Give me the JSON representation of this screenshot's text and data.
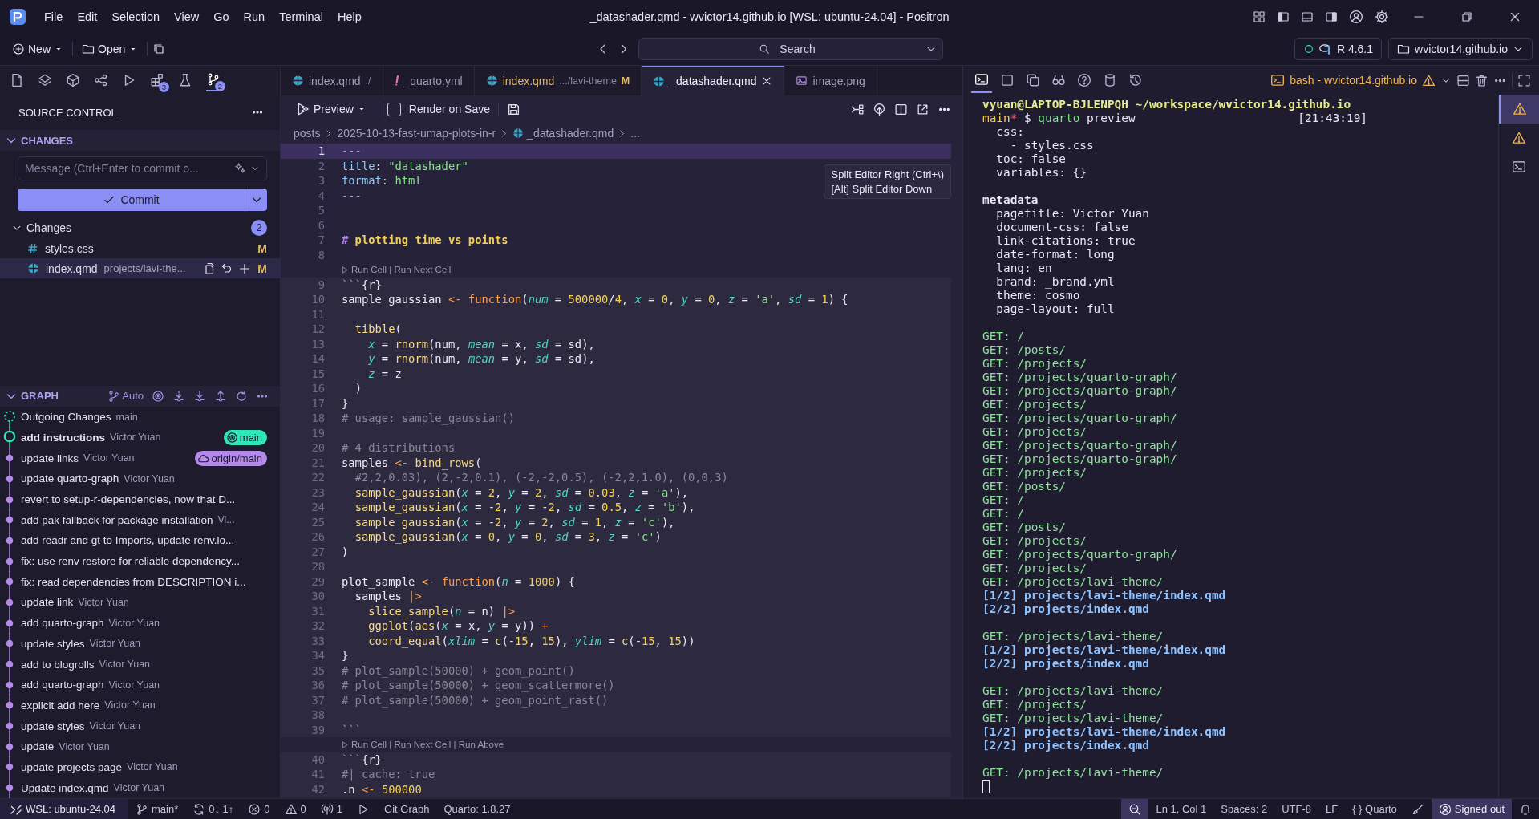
{
  "title_bar": {
    "menu": [
      "File",
      "Edit",
      "Selection",
      "View",
      "Go",
      "Run",
      "Terminal",
      "Help"
    ],
    "title": "_datashader.qmd - wvictor14.github.io [WSL: ubuntu-24.04] - Positron"
  },
  "toolbar": {
    "new": "New",
    "open": "Open",
    "search": {
      "placeholder": "Search"
    },
    "interpreter": "R 4.6.1",
    "workspace": "wvictor14.github.io"
  },
  "activity": [
    {
      "kind": "files",
      "selected": false
    },
    {
      "kind": "layers",
      "selected": false
    },
    {
      "kind": "cube",
      "selected": false
    },
    {
      "kind": "share",
      "selected": false
    },
    {
      "kind": "run",
      "selected": false
    },
    {
      "kind": "blocks",
      "badge": "3",
      "selected": false
    },
    {
      "kind": "flask",
      "selected": false
    },
    {
      "kind": "branch",
      "badge": "2",
      "selected": true
    }
  ],
  "source_control": {
    "title": "SOURCE CONTROL",
    "section": "CHANGES",
    "message": {
      "placeholder": "Message (Ctrl+Enter to commit o..."
    },
    "commit": "Commit",
    "group": {
      "label": "Changes",
      "count": "2"
    },
    "files": [
      {
        "kind": "css",
        "name": "styles.css",
        "status": "M",
        "selected": false
      },
      {
        "kind": "qmd",
        "name": "index.qmd",
        "path": "projects/lavi-the...",
        "status": "M",
        "selected": true
      }
    ]
  },
  "graph": {
    "title": "GRAPH",
    "mode": "Auto",
    "commits": [
      {
        "kind": "outgoing",
        "message": "Outgoing Changes",
        "author": "main"
      },
      {
        "kind": "head",
        "message": "add instructions",
        "author": "Victor Yuan",
        "refs": [
          {
            "kind": "local",
            "label": "main"
          }
        ]
      },
      {
        "kind": "commit",
        "message": "update links",
        "author": "Victor Yuan",
        "refs": [
          {
            "kind": "remote",
            "label": "origin/main"
          }
        ]
      },
      {
        "kind": "commit",
        "message": "update quarto-graph",
        "author": "Victor Yuan"
      },
      {
        "kind": "commit",
        "message": "revert to setup-r-dependencies, now that D..."
      },
      {
        "kind": "commit",
        "message": "add pak fallback for package installation",
        "author": "Vi..."
      },
      {
        "kind": "commit",
        "message": "add readr and gt to Imports, update renv.lo..."
      },
      {
        "kind": "commit",
        "message": "fix: use renv restore for reliable dependency..."
      },
      {
        "kind": "commit",
        "message": "fix: read dependencies from DESCRIPTION i..."
      },
      {
        "kind": "commit",
        "message": "update link",
        "author": "Victor Yuan"
      },
      {
        "kind": "commit",
        "message": "add quarto-graph",
        "author": "Victor Yuan"
      },
      {
        "kind": "commit",
        "message": "update styles",
        "author": "Victor Yuan"
      },
      {
        "kind": "commit",
        "message": "add to blogrolls",
        "author": "Victor Yuan"
      },
      {
        "kind": "commit",
        "message": "add quarto-graph",
        "author": "Victor Yuan"
      },
      {
        "kind": "commit",
        "message": "explicit add here",
        "author": "Victor Yuan"
      },
      {
        "kind": "commit",
        "message": "update styles",
        "author": "Victor Yuan"
      },
      {
        "kind": "commit",
        "message": "update",
        "author": "Victor Yuan"
      },
      {
        "kind": "commit",
        "message": "update projects page",
        "author": "Victor Yuan"
      },
      {
        "kind": "commit",
        "message": "Update index.qmd",
        "author": "Victor Yuan"
      }
    ]
  },
  "tabs": [
    {
      "kind": "qmd",
      "label": "index.qmd",
      "description": "./",
      "selected": false
    },
    {
      "kind": "yml",
      "label": "_quarto.yml",
      "selected": false
    },
    {
      "kind": "qmd",
      "label": "index.qmd",
      "description": ".../lavi-theme",
      "status": "M",
      "selected": false
    },
    {
      "kind": "qmd",
      "label": "_datashader.qmd",
      "selected": true
    },
    {
      "kind": "png",
      "label": "image.png",
      "selected": false
    }
  ],
  "editor": {
    "preview": "Preview",
    "render_on_save": {
      "label": "Render on Save",
      "checked": false
    },
    "tooltip": [
      "Split Editor Right (Ctrl+\\)",
      "[Alt] Split Editor Down"
    ],
    "breadcrumbs": [
      "posts",
      "2025-10-13-fast-umap-plots-in-r",
      "_datashader.qmd",
      "..."
    ],
    "blocks": [
      {
        "kind": "yaml",
        "lines": [
          {
            "n": "1",
            "text": "---",
            "current": true
          },
          {
            "n": "2",
            "text": "title: \"datashader\"",
            "current": false
          },
          {
            "n": "3",
            "text": "format: html",
            "current": false
          },
          {
            "n": "4",
            "text": "---",
            "current": false
          }
        ]
      },
      {
        "kind": "markdown",
        "lines": [
          {
            "n": "5",
            "current": false
          },
          {
            "n": "6",
            "current": false
          },
          {
            "n": "7",
            "text": "# plotting time vs points",
            "current": false
          },
          {
            "n": "8",
            "current": false
          }
        ]
      },
      {
        "kind": "chunk",
        "codelens": "Run Cell | Run Next Cell",
        "lines": [
          {
            "n": "9",
            "text": "```{r}",
            "current": false
          },
          {
            "n": "10",
            "text": "sample_gaussian <- function(num = 500000/4, x = 0, y = 0, z = 'a', sd = 1) {",
            "current": false
          },
          {
            "n": "11",
            "current": false
          },
          {
            "n": "12",
            "text": "  tibble(",
            "current": false
          },
          {
            "n": "13",
            "text": "    x = rnorm(num, mean = x, sd = sd),",
            "current": false
          },
          {
            "n": "14",
            "text": "    y = rnorm(num, mean = y, sd = sd),",
            "current": false
          },
          {
            "n": "15",
            "text": "    z = z",
            "current": false
          },
          {
            "n": "16",
            "text": "  )",
            "current": false
          },
          {
            "n": "17",
            "text": "}",
            "current": false
          },
          {
            "n": "18",
            "text": "# usage: sample_gaussian()",
            "current": false
          },
          {
            "n": "19",
            "current": false
          },
          {
            "n": "20",
            "text": "# 4 distributions",
            "current": false
          },
          {
            "n": "21",
            "text": "samples <- bind_rows(",
            "current": false
          },
          {
            "n": "22",
            "text": "  #2,2,0.03), (2,-2,0.1), (-2,-2,0.5), (-2,2,1.0), (0,0,3)",
            "current": false
          },
          {
            "n": "23",
            "text": "  sample_gaussian(x = 2, y = 2, sd = 0.03, z = 'a'),",
            "current": false
          },
          {
            "n": "24",
            "text": "  sample_gaussian(x = -2, y = -2, sd = 0.5, z = 'b'),",
            "current": false
          },
          {
            "n": "25",
            "text": "  sample_gaussian(x = -2, y = 2, sd = 1, z = 'c'),",
            "current": false
          },
          {
            "n": "26",
            "text": "  sample_gaussian(x = 0, y = 0, sd = 3, z = 'c')",
            "current": false
          },
          {
            "n": "27",
            "text": ")",
            "current": false
          },
          {
            "n": "28",
            "current": false
          },
          {
            "n": "29",
            "text": "plot_sample <- function(n = 1000) {",
            "current": false
          },
          {
            "n": "30",
            "text": "  samples |>",
            "current": false
          },
          {
            "n": "31",
            "text": "    slice_sample(n = n) |>",
            "current": false
          },
          {
            "n": "32",
            "text": "    ggplot(aes(x = x, y = y)) +",
            "current": false
          },
          {
            "n": "33",
            "text": "    coord_equal(xlim = c(-15, 15), ylim = c(-15, 15))",
            "current": false
          },
          {
            "n": "34",
            "text": "}",
            "current": false
          },
          {
            "n": "35",
            "text": "# plot_sample(50000) + geom_point()",
            "current": false
          },
          {
            "n": "36",
            "text": "# plot_sample(50000) + geom_scattermore()",
            "current": false
          },
          {
            "n": "37",
            "text": "# plot_sample(50000) + geom_point_rast()",
            "current": false
          },
          {
            "n": "38",
            "current": false
          },
          {
            "n": "39",
            "text": "```",
            "current": false
          }
        ]
      },
      {
        "kind": "chunk",
        "codelens": "Run Cell | Run Next Cell | Run Above",
        "lines": [
          {
            "n": "40",
            "text": "```{r}",
            "current": false
          },
          {
            "n": "41",
            "text": "#| cache: true",
            "current": false
          },
          {
            "n": "42",
            "text": ".n <- 500000",
            "current": false
          }
        ]
      }
    ]
  },
  "terminal": {
    "tabs": [
      {
        "kind": "terminal",
        "selected": true
      },
      {
        "kind": "square",
        "selected": false
      },
      {
        "kind": "copy",
        "selected": false
      },
      {
        "kind": "glasses",
        "selected": false
      },
      {
        "kind": "help",
        "selected": false
      },
      {
        "kind": "database",
        "selected": false
      },
      {
        "kind": "history",
        "selected": false
      }
    ],
    "session": "bash - wvictor14.github.io",
    "side": [
      {
        "kind": "warning",
        "selected": true
      },
      {
        "kind": "warning",
        "selected": false
      },
      {
        "kind": "terminal",
        "selected": false
      }
    ],
    "lines": [
      {
        "kind": "path",
        "text": "vyuan@LAPTOP-BJLENPQH ~/workspace/wvictor14.github.io"
      },
      {
        "kind": "command",
        "branch": "main",
        "dirty": "*",
        "symbol": "$",
        "command": "quarto",
        "args": "preview",
        "time": "[21:43:19]"
      },
      {
        "kind": "plain",
        "text": "  css:"
      },
      {
        "kind": "plain",
        "text": "    - styles.css"
      },
      {
        "kind": "plain",
        "text": "  toc: false"
      },
      {
        "kind": "plain",
        "text": "  variables: {}"
      },
      {
        "kind": "blank"
      },
      {
        "kind": "heading",
        "text": "metadata"
      },
      {
        "kind": "plain",
        "text": "  pagetitle: Victor Yuan"
      },
      {
        "kind": "plain",
        "text": "  document-css: false"
      },
      {
        "kind": "plain",
        "text": "  link-citations: true"
      },
      {
        "kind": "plain",
        "text": "  date-format: long"
      },
      {
        "kind": "plain",
        "text": "  lang: en"
      },
      {
        "kind": "plain",
        "text": "  brand: _brand.yml"
      },
      {
        "kind": "plain",
        "text": "  theme: cosmo"
      },
      {
        "kind": "plain",
        "text": "  page-layout: full"
      },
      {
        "kind": "blank"
      },
      {
        "kind": "get",
        "text": "GET: /"
      },
      {
        "kind": "get",
        "text": "GET: /posts/"
      },
      {
        "kind": "get",
        "text": "GET: /projects/"
      },
      {
        "kind": "get",
        "text": "GET: /projects/quarto-graph/"
      },
      {
        "kind": "get",
        "text": "GET: /projects/quarto-graph/"
      },
      {
        "kind": "get",
        "text": "GET: /projects/"
      },
      {
        "kind": "get",
        "text": "GET: /projects/quarto-graph/"
      },
      {
        "kind": "get",
        "text": "GET: /projects/"
      },
      {
        "kind": "get",
        "text": "GET: /projects/quarto-graph/"
      },
      {
        "kind": "get",
        "text": "GET: /projects/quarto-graph/"
      },
      {
        "kind": "get",
        "text": "GET: /projects/"
      },
      {
        "kind": "get",
        "text": "GET: /posts/"
      },
      {
        "kind": "get",
        "text": "GET: /"
      },
      {
        "kind": "get",
        "text": "GET: /"
      },
      {
        "kind": "get",
        "text": "GET: /posts/"
      },
      {
        "kind": "get",
        "text": "GET: /projects/"
      },
      {
        "kind": "get",
        "text": "GET: /projects/quarto-graph/"
      },
      {
        "kind": "get",
        "text": "GET: /projects/"
      },
      {
        "kind": "get",
        "text": "GET: /projects/lavi-theme/"
      },
      {
        "kind": "render",
        "text": "[1/2] projects/lavi-theme/index.qmd"
      },
      {
        "kind": "render",
        "text": "[2/2] projects/index.qmd"
      },
      {
        "kind": "blank"
      },
      {
        "kind": "get",
        "text": "GET: /projects/lavi-theme/"
      },
      {
        "kind": "render",
        "text": "[1/2] projects/lavi-theme/index.qmd"
      },
      {
        "kind": "render",
        "text": "[2/2] projects/index.qmd"
      },
      {
        "kind": "blank"
      },
      {
        "kind": "get",
        "text": "GET: /projects/lavi-theme/"
      },
      {
        "kind": "get",
        "text": "GET: /projects/"
      },
      {
        "kind": "get",
        "text": "GET: /projects/lavi-theme/"
      },
      {
        "kind": "render",
        "text": "[1/2] projects/lavi-theme/index.qmd"
      },
      {
        "kind": "render",
        "text": "[2/2] projects/index.qmd"
      },
      {
        "kind": "blank"
      },
      {
        "kind": "get",
        "text": "GET: /projects/lavi-theme/"
      },
      {
        "kind": "cursor"
      }
    ]
  },
  "status_bar": {
    "left": [
      {
        "kind": "remote",
        "label": "WSL: ubuntu-24.04"
      },
      {
        "kind": "branch",
        "label": "main*"
      },
      {
        "kind": "sync",
        "label": "0↓ 1↑"
      },
      {
        "kind": "errors",
        "label": "0"
      },
      {
        "kind": "warnings",
        "label": "0"
      },
      {
        "kind": "ports",
        "label": "1"
      },
      {
        "kind": "run"
      },
      {
        "kind": "text",
        "label": "Git Graph"
      },
      {
        "kind": "text",
        "label": "Quarto: 1.8.27"
      }
    ],
    "right": [
      {
        "kind": "zoom"
      },
      {
        "kind": "text",
        "label": "Ln 1, Col 1"
      },
      {
        "kind": "text",
        "label": "Spaces: 2"
      },
      {
        "kind": "text",
        "label": "UTF-8"
      },
      {
        "kind": "text",
        "label": "LF"
      },
      {
        "kind": "language",
        "glyph": "{ }",
        "label": "Quarto"
      },
      {
        "kind": "brush"
      },
      {
        "kind": "account",
        "label": "Signed out"
      },
      {
        "kind": "bell"
      }
    ]
  }
}
